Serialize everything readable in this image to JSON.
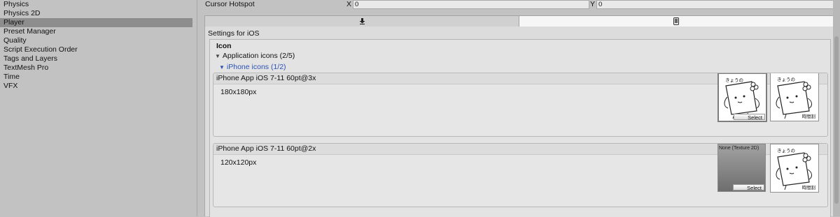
{
  "sidebar": {
    "items": [
      {
        "label": "Physics",
        "selected": false
      },
      {
        "label": "Physics 2D",
        "selected": false
      },
      {
        "label": "Player",
        "selected": true
      },
      {
        "label": "Preset Manager",
        "selected": false
      },
      {
        "label": "Quality",
        "selected": false
      },
      {
        "label": "Script Execution Order",
        "selected": false
      },
      {
        "label": "Tags and Layers",
        "selected": false
      },
      {
        "label": "TextMesh Pro",
        "selected": false
      },
      {
        "label": "Time",
        "selected": false
      },
      {
        "label": "VFX",
        "selected": false
      }
    ]
  },
  "cursor_hotspot": {
    "label": "Cursor Hotspot",
    "x_label": "X",
    "x_value": "0",
    "y_label": "Y",
    "y_value": "0"
  },
  "platform_tabs": {
    "standalone_icon": "download-icon",
    "ios_icon": "phone-icon",
    "selected": "ios"
  },
  "settings": {
    "title": "Settings for iOS",
    "icon_heading": "Icon",
    "application_icons": "Application icons (2/5)",
    "iphone_icons": "iPhone icons (1/2)"
  },
  "slots": [
    {
      "header": "iPhone App iOS 7-11 60pt@3x",
      "size": "180x180px",
      "texture": "assigned",
      "select_label": "Select",
      "art_top_text": "きょうの",
      "art_bottom_text": "時間割"
    },
    {
      "header": "iPhone App iOS 7-11 60pt@2x",
      "size": "120x120px",
      "texture": "none",
      "none_label": "None (Texture 2D)",
      "select_label": "Select",
      "art_top_text": "きょうの",
      "art_bottom_text": "時間割"
    }
  ],
  "colors": {
    "link_blue": "#2b51b8",
    "selected_row": "#8d8d8d",
    "active_tab": "#f6f6f6"
  }
}
